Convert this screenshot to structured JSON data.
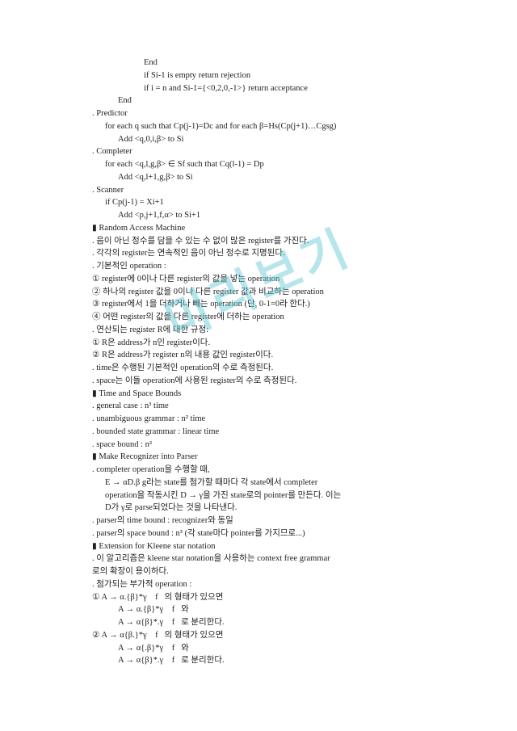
{
  "watermark": "미리보기",
  "lines": [
    {
      "indent": 5,
      "text": "End"
    },
    {
      "indent": 5,
      "text": "if Si-1 is empty return rejection"
    },
    {
      "indent": 5,
      "text": "if i = n and Si-1={<0,2,0,-1>} return acceptance"
    },
    {
      "indent": 3,
      "text": "End"
    },
    {
      "indent": 1,
      "text": ". Predictor"
    },
    {
      "indent": 2,
      "text": "for each q such that Cp(j-1)=Dc and for each β=Hs(Cp(j+1)…Cgsg)"
    },
    {
      "indent": 3,
      "text": "Add <q,0,i,β> to Si"
    },
    {
      "indent": 1,
      "text": ". Completer"
    },
    {
      "indent": 2,
      "text": "for each <q,l,g,β> ∈ Sf such that Cq(l-1) = Dp"
    },
    {
      "indent": 3,
      "text": "Add <q,l+1,g,β> to Si"
    },
    {
      "indent": 1,
      "text": ". Scanner"
    },
    {
      "indent": 2,
      "text": "if Cp(j-1) = Xi+1"
    },
    {
      "indent": 3,
      "text": "Add <p,j+1,f,α> to Si+1"
    },
    {
      "indent": 1,
      "text": "▮ Random Access Machine"
    },
    {
      "indent": 1,
      "text": ". 음이 아닌 정수를 담을 수 있는 수 없이 많은 register를 가진다."
    },
    {
      "indent": 1,
      "text": ". 각각의 register는 연속적인 음이 아닌 정수로 지명된다."
    },
    {
      "indent": 1,
      "text": ". 기본적인 operation :"
    },
    {
      "indent": 1,
      "text": "① register에 0이나 다른 register의 값을 넣는 operation"
    },
    {
      "indent": 1,
      "text": "② 하나의 register 값을 0이나 다른 register 값과 비교하는 operation"
    },
    {
      "indent": 1,
      "text": "③ register에서 1을 더하거나 빼는 operation (단, 0-1=0라 한다.)"
    },
    {
      "indent": 1,
      "text": "④ 어떤 register의 값을 다른 register에 더하는 operation"
    },
    {
      "indent": 1,
      "text": ". 연산되는 register R에 대한 규정:"
    },
    {
      "indent": 1,
      "text": "① R은 address가 n인 register이다."
    },
    {
      "indent": 1,
      "text": "② R은 address가 register n의 내용 값인 register이다."
    },
    {
      "indent": 1,
      "text": ". time은 수행된 기본적인 operation의 수로 측정된다."
    },
    {
      "indent": 1,
      "text": ". space는 이들 operation에 사용된 register의 수로 측정된다."
    },
    {
      "indent": 1,
      "text": "▮ Time and Space Bounds"
    },
    {
      "indent": 1,
      "text": ". general case : n³ time"
    },
    {
      "indent": 1,
      "text": ". unambiguous grammar : n² time"
    },
    {
      "indent": 1,
      "text": ". bounded state grammar : linear time"
    },
    {
      "indent": 1,
      "text": ". space bound : n²"
    },
    {
      "indent": 1,
      "text": "▮ Make Recognizer into Parser"
    },
    {
      "indent": 1,
      "text": ". completer operation을 수행할 때,"
    },
    {
      "indent": 2,
      "text": "E → αD.β g라는 state를 첨가할 때마다 각 state에서 completer"
    },
    {
      "indent": 2,
      "text": "operation을 작동시킨 D → γ을 가진 state로의 pointer를 만든다. 이는"
    },
    {
      "indent": 2,
      "text": "D가 γ로 parse되었다는 것을 나타낸다."
    },
    {
      "indent": 1,
      "text": ". parser의 time bound : recognizer와 동일"
    },
    {
      "indent": 1,
      "text": ". parser의 space bound : n³ (각 state마다 pointer를 가지므로...)"
    },
    {
      "indent": 1,
      "text": "▮ Extension for Kleene star notation"
    },
    {
      "indent": 1,
      "text": ". 이 알고리즘은 kleene star notation을 사용하는 context free grammar"
    },
    {
      "indent": 1,
      "text": "로의 확장이 용이하다."
    },
    {
      "indent": 1,
      "text": ". 첨가되는 부가적 operation :"
    },
    {
      "indent": 1,
      "text": "① A → α.{β}*γ    f   의 형태가 있으면"
    },
    {
      "indent": 3,
      "text": "A → α.{β}*γ    f   와"
    },
    {
      "indent": 3,
      "text": "A → α{β}*.γ    f   로 분리한다."
    },
    {
      "indent": 1,
      "text": "② A → α{β.}*γ    f   의 형태가 있으면"
    },
    {
      "indent": 3,
      "text": "A → α{.β}*γ    f   와"
    },
    {
      "indent": 3,
      "text": "A → α{β}*.γ    f   로 분리한다."
    }
  ]
}
